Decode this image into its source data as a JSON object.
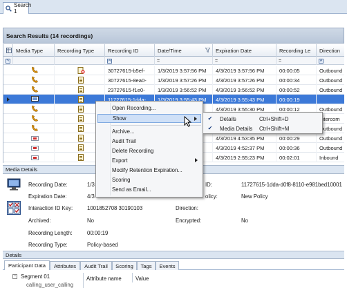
{
  "tab": {
    "label": "Search 1"
  },
  "results": {
    "title": "Search Results (14 recordings)"
  },
  "grid": {
    "columns": [
      "Media Type",
      "Recording Type",
      "Recording ID",
      "Date/Time",
      "Expiration Date",
      "Recording Le",
      "Direction"
    ],
    "rows": [
      {
        "id": "30727615-b5ef-",
        "date": "1/3/2019 3:57:56 PM",
        "exp": "4/3/2019 3:57:56 PM",
        "len": "00:00:05",
        "dir": "Outbound",
        "media": "phone",
        "rtype": "doc-x"
      },
      {
        "id": "30727615-8ea0-",
        "date": "1/3/2019 3:57:26 PM",
        "exp": "4/3/2019 3:57:26 PM",
        "len": "00:00:34",
        "dir": "Outbound",
        "media": "phone",
        "rtype": "doc"
      },
      {
        "id": "23727615-f1e0-",
        "date": "1/3/2019 3:56:52 PM",
        "exp": "4/3/2019 3:56:52 PM",
        "len": "00:00:52",
        "dir": "Outbound",
        "media": "phone",
        "rtype": "doc"
      },
      {
        "id": "11727615-1dda-",
        "date": "1/3/2019 3:55:43 PM",
        "exp": "4/3/2019 3:55:43 PM",
        "len": "00:00:19",
        "dir": "",
        "media": "screen",
        "rtype": "doc"
      },
      {
        "id": "",
        "date": "",
        "exp": "4/3/2019 3:55:30 PM",
        "len": "00:00:12",
        "dir": "Outbound",
        "media": "phone",
        "rtype": "doc"
      },
      {
        "id": "",
        "date": "",
        "exp": "",
        "len": "",
        "dir": "Intercom",
        "media": "phone",
        "rtype": "doc"
      },
      {
        "id": "",
        "date": "",
        "exp": "",
        "len": "",
        "dir": "Outbound",
        "media": "phone",
        "rtype": "doc"
      },
      {
        "id": "",
        "date": "",
        "exp": "4/3/2019 4:53:35 PM",
        "len": "00:00:29",
        "dir": "Outbound",
        "media": "email",
        "rtype": "doc"
      },
      {
        "id": "",
        "date": "",
        "exp": "4/3/2019 4:52:37 PM",
        "len": "00:00:36",
        "dir": "Outbound",
        "media": "email",
        "rtype": "doc"
      },
      {
        "id": "",
        "date": "",
        "exp": "4/3/2019 2:55:23 PM",
        "len": "00:02:01",
        "dir": "Inbound",
        "media": "email",
        "rtype": "doc"
      }
    ]
  },
  "context_menu": {
    "items": [
      "Open Recording...",
      "Show",
      "Archive...",
      "Audit Trail",
      "Delete Recording",
      "Export",
      "Modify Retention Expiration...",
      "Scoring",
      "Send as Email..."
    ]
  },
  "submenu": {
    "items": [
      {
        "label": "Details",
        "shortcut": "Ctrl+Shift+D"
      },
      {
        "label": "Media Details",
        "shortcut": "Ctrl+Shift+M"
      }
    ]
  },
  "media_details": {
    "title": "Media Details",
    "recording_date_label": "Recording Date:",
    "recording_date_value": "1/3",
    "expiration_date_label": "Expiration Date:",
    "expiration_date_value": "4/3",
    "id_label": "ID:",
    "id_value": "11727615-1dda-d0f8-8110-e981bed10001",
    "policy_label": "olicy:",
    "policy_value": "New Policy",
    "interaction_id_label": "Interaction ID Key:",
    "interaction_id_value": "1001852708 30190103",
    "direction_label": "Direction:",
    "archived_label": "Archived:",
    "archived_value": "No",
    "encrypted_label": "Encrypted:",
    "encrypted_value": "No",
    "length_label": "Recording Length:",
    "length_value": "00:00:19",
    "type_label": "Recording Type:",
    "type_value": "Policy-based"
  },
  "details": {
    "title": "Details",
    "tabs": [
      "Participant Data",
      "Attributes",
      "Audit Trail",
      "Scoring",
      "Tags",
      "Events"
    ],
    "tree_item": "Segment 01",
    "tree_sub": "calling_user_calling",
    "col_attr": "Attribute name",
    "col_value": "Value"
  }
}
